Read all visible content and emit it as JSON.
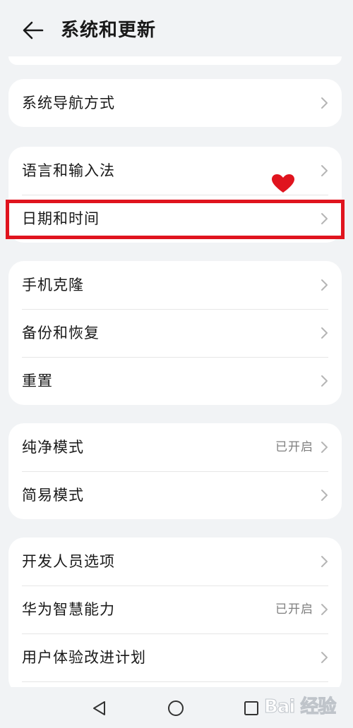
{
  "header": {
    "title": "系统和更新",
    "back_icon": "arrow-left-icon"
  },
  "groups": [
    {
      "items": [
        {
          "label": "系统导航方式"
        }
      ]
    },
    {
      "items": [
        {
          "label": "语言和输入法"
        },
        {
          "label": "日期和时间"
        }
      ]
    },
    {
      "items": [
        {
          "label": "手机克隆"
        },
        {
          "label": "备份和恢复"
        },
        {
          "label": "重置"
        }
      ]
    },
    {
      "items": [
        {
          "label": "纯净模式",
          "value": "已开启"
        },
        {
          "label": "简易模式"
        }
      ]
    },
    {
      "items": [
        {
          "label": "开发人员选项"
        },
        {
          "label": "华为智慧能力",
          "value": "已开启"
        },
        {
          "label": "用户体验改进计划"
        }
      ]
    }
  ],
  "annotation": {
    "highlight_color": "#e0141e",
    "heart_color": "#e0141e"
  },
  "navbar": {
    "icons": [
      "back-triangle-icon",
      "home-circle-icon",
      "recents-square-icon"
    ]
  },
  "watermark": {
    "text": "Bai 经验"
  },
  "colors": {
    "background": "#f1f3f5",
    "card": "#ffffff",
    "text": "#191919",
    "secondary": "#7f7f7f"
  }
}
